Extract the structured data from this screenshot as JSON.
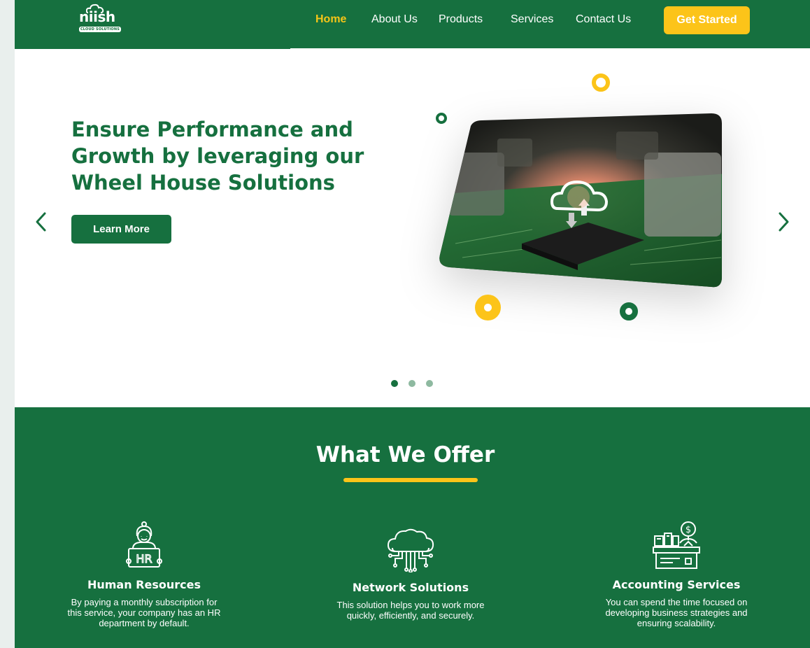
{
  "brand": {
    "logo_text": "niish",
    "logo_tagline": "CLOUD SOLUTIONS"
  },
  "nav": {
    "items": [
      {
        "label": "Home",
        "active": true
      },
      {
        "label": "About Us",
        "active": false
      },
      {
        "label": "Products",
        "active": false
      },
      {
        "label": "Services",
        "active": false
      },
      {
        "label": "Contact Us",
        "active": false
      }
    ],
    "cta_label": "Get Started"
  },
  "hero": {
    "title": "Ensure Performance and Growth by leveraging our Wheel House Solutions",
    "button_label": "Learn More",
    "prev_icon": "chevron-left-icon",
    "next_icon": "chevron-right-icon",
    "image_icon": "cloud-chip-image",
    "slides_total": 3,
    "active_slide": 1
  },
  "offer": {
    "title": "What We Offer",
    "cards": [
      {
        "icon": "hr-person-icon",
        "title": "Human Resources",
        "description": "By paying a monthly subscription for this service, your company has an HR department by default."
      },
      {
        "icon": "cloud-network-icon",
        "title": "Network Solutions",
        "description": "This solution helps you to work more quickly, efficiently, and securely."
      },
      {
        "icon": "accounting-desk-icon",
        "title": "Accounting Services",
        "description": "You can spend the time focused on developing business strategies and ensuring scalability."
      }
    ]
  },
  "colors": {
    "brand_green": "#16703f",
    "accent_yellow": "#fcc419",
    "nav_active": "#f5c518"
  }
}
